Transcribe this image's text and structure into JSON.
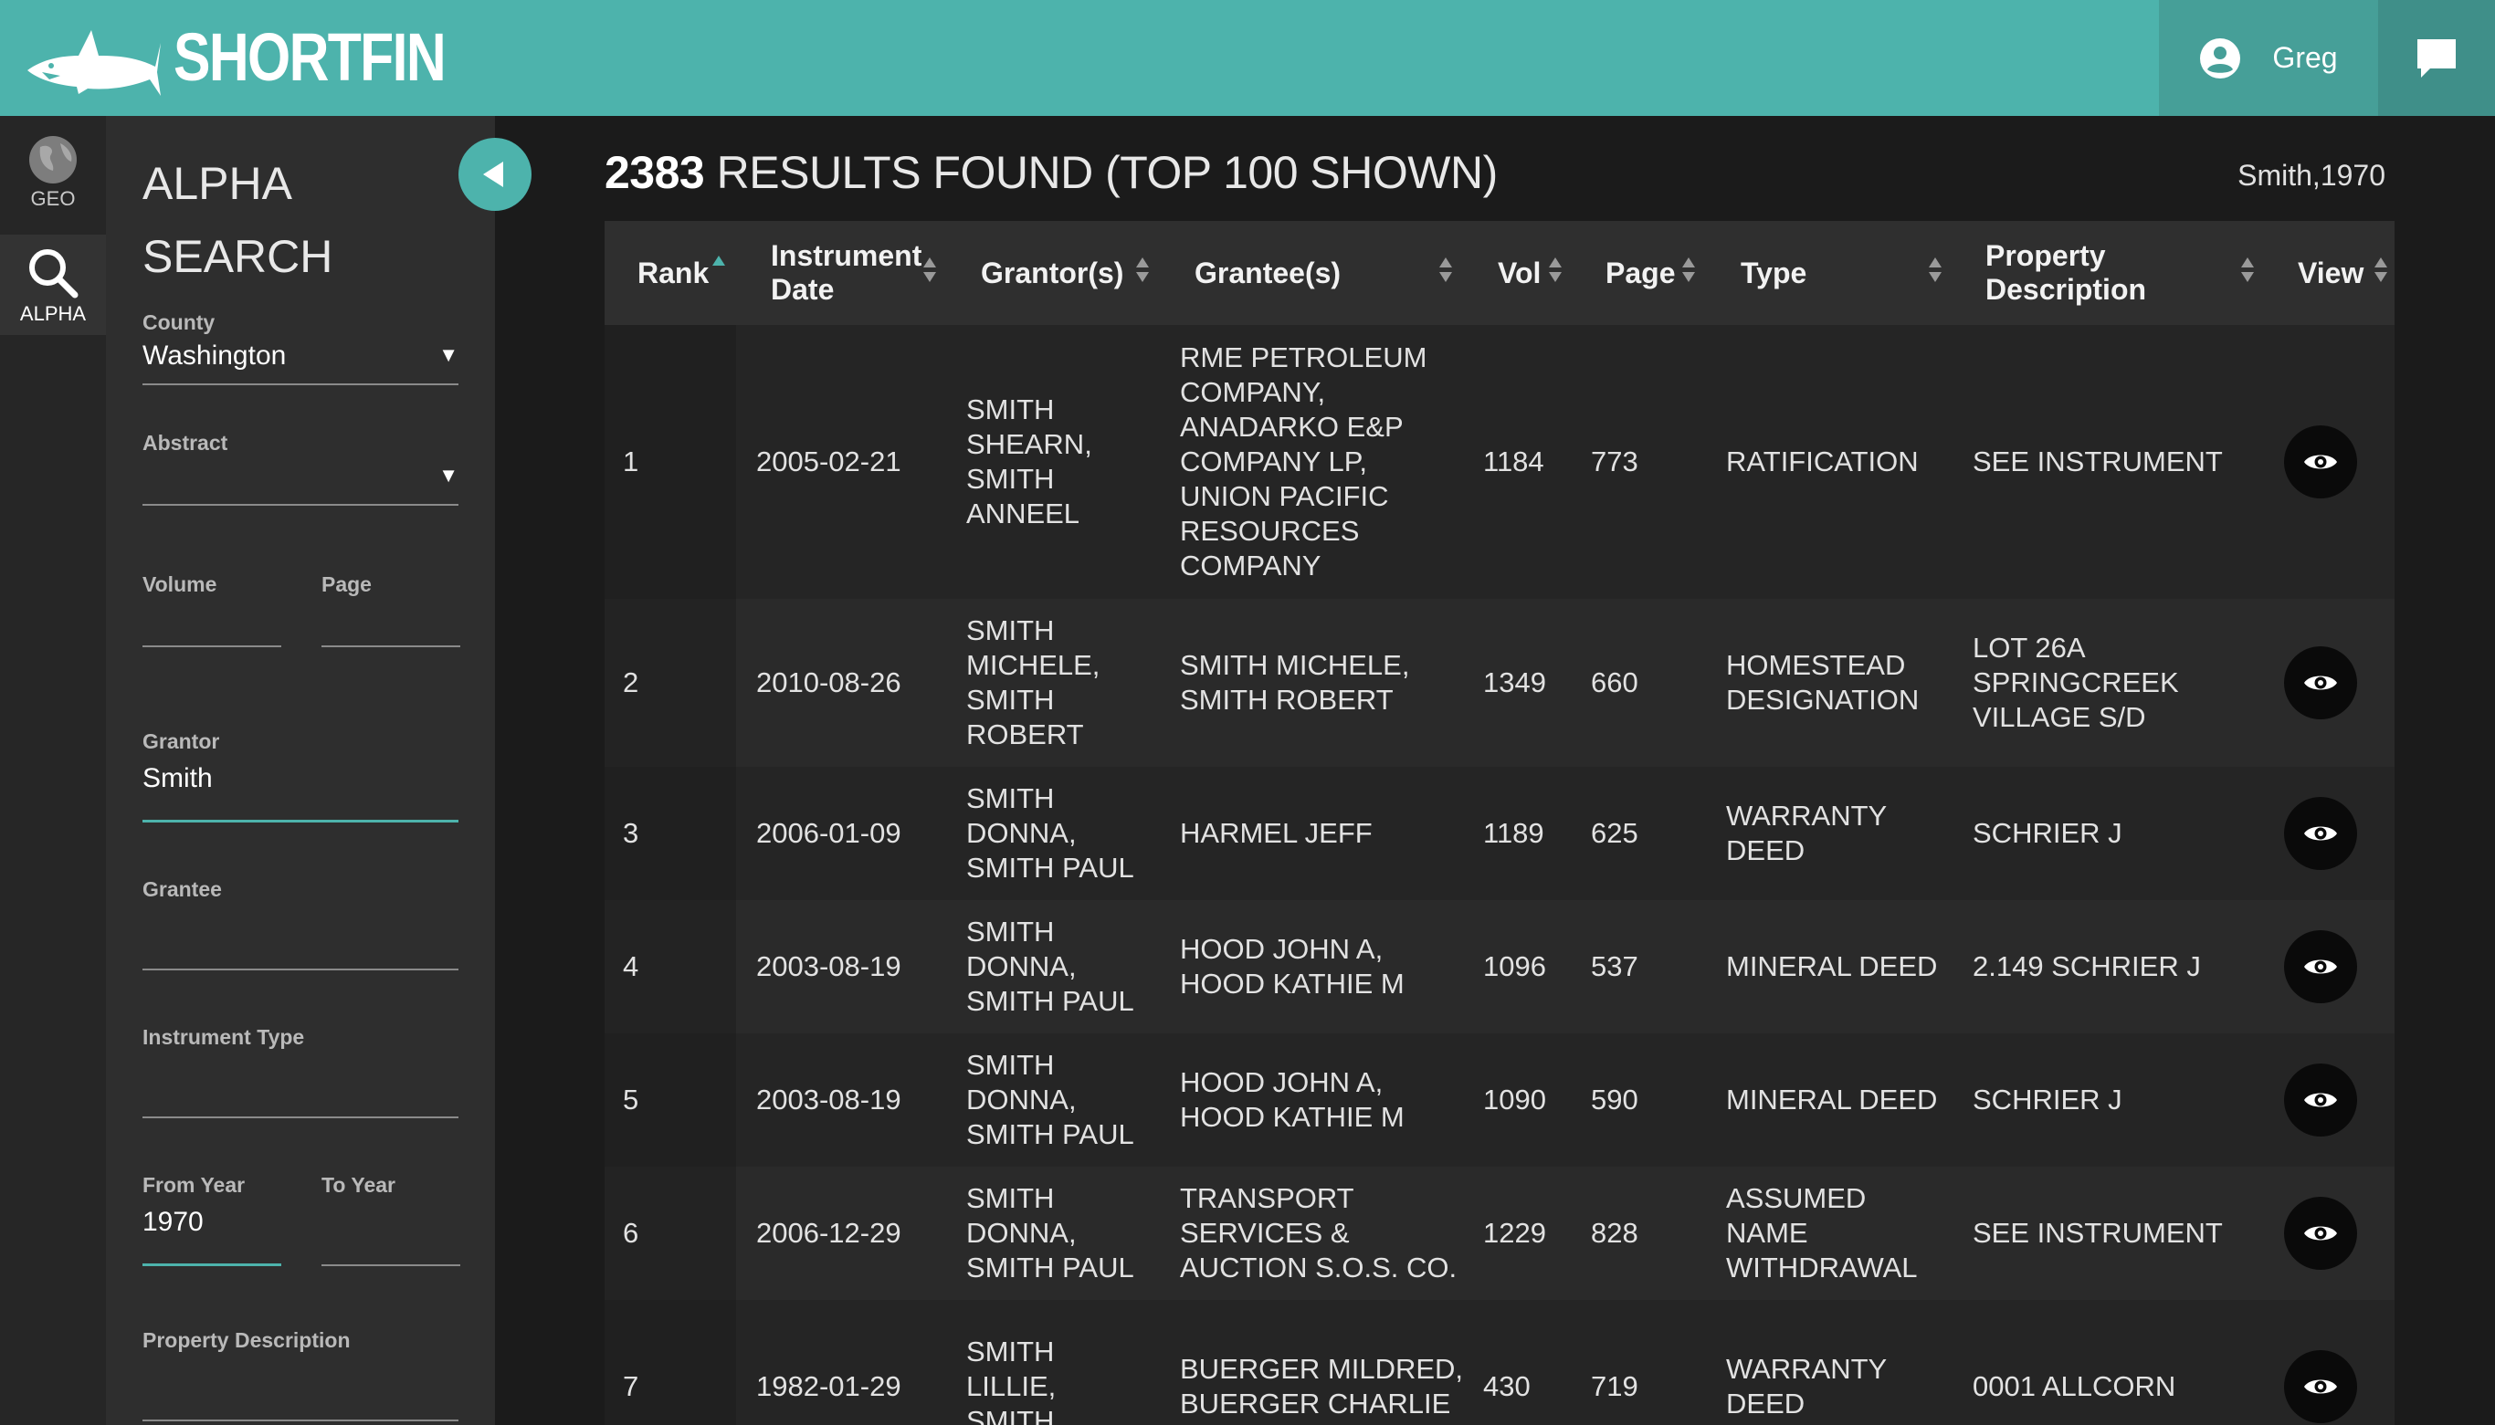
{
  "header": {
    "brand": "SHORTFIN",
    "user_name": "Greg",
    "colors": {
      "accent": "#4db3ac",
      "user_bg": "#469f98",
      "chat_bg": "#3f8f89"
    }
  },
  "rail": {
    "items": [
      {
        "label": "GEO",
        "icon": "globe-icon"
      },
      {
        "label": "ALPHA",
        "icon": "search-icon"
      }
    ]
  },
  "search_panel": {
    "title_line1": "ALPHA",
    "title_line2": "SEARCH",
    "fields": {
      "county": {
        "label": "County",
        "value": "Washington"
      },
      "abstract": {
        "label": "Abstract",
        "value": ""
      },
      "volume": {
        "label": "Volume",
        "value": ""
      },
      "page": {
        "label": "Page",
        "value": ""
      },
      "grantor": {
        "label": "Grantor",
        "value": "Smith"
      },
      "grantee": {
        "label": "Grantee",
        "value": ""
      },
      "instrument_type": {
        "label": "Instrument Type",
        "value": ""
      },
      "from_year": {
        "label": "From Year",
        "value": "1970"
      },
      "to_year": {
        "label": "To Year",
        "value": ""
      },
      "property_description": {
        "label": "Property Description",
        "value": ""
      }
    }
  },
  "results": {
    "count": "2383",
    "title_rest": "RESULTS FOUND (TOP 100 SHOWN)",
    "query": "Smith,1970",
    "columns": {
      "rank": "Rank",
      "instrument_date_1": "Instrument",
      "instrument_date_2": "Date",
      "grantors": "Grantor(s)",
      "grantees": "Grantee(s)",
      "vol": "Vol",
      "page": "Page",
      "type": "Type",
      "property_1": "Property",
      "property_2": "Description",
      "view": "View"
    },
    "rows": [
      {
        "rank": "1",
        "date": "2005-02-21",
        "grantor": [
          "SMITH",
          "SHEARN,",
          "SMITH",
          "ANNEEL"
        ],
        "grantee": [
          "RME PETROLEUM",
          "COMPANY,",
          "ANADARKO E&P",
          "COMPANY LP,",
          "UNION PACIFIC",
          "RESOURCES",
          "COMPANY"
        ],
        "vol": "1184",
        "page": "773",
        "type": [
          "RATIFICATION"
        ],
        "property": [
          "SEE INSTRUMENT"
        ]
      },
      {
        "rank": "2",
        "date": "2010-08-26",
        "grantor": [
          "SMITH",
          "MICHELE,",
          "SMITH",
          "ROBERT"
        ],
        "grantee": [
          "SMITH MICHELE,",
          "SMITH ROBERT"
        ],
        "vol": "1349",
        "page": "660",
        "type": [
          "HOMESTEAD",
          "DESIGNATION"
        ],
        "property": [
          "LOT 26A",
          "SPRINGCREEK",
          "VILLAGE S/D"
        ]
      },
      {
        "rank": "3",
        "date": "2006-01-09",
        "grantor": [
          "SMITH",
          "DONNA,",
          "SMITH PAUL"
        ],
        "grantee": [
          "HARMEL JEFF"
        ],
        "vol": "1189",
        "page": "625",
        "type": [
          "WARRANTY",
          "DEED"
        ],
        "property": [
          "SCHRIER J"
        ]
      },
      {
        "rank": "4",
        "date": "2003-08-19",
        "grantor": [
          "SMITH",
          "DONNA,",
          "SMITH PAUL"
        ],
        "grantee": [
          "HOOD JOHN A,",
          "HOOD KATHIE M"
        ],
        "vol": "1096",
        "page": "537",
        "type": [
          "MINERAL DEED"
        ],
        "property": [
          "2.149 SCHRIER J"
        ]
      },
      {
        "rank": "5",
        "date": "2003-08-19",
        "grantor": [
          "SMITH",
          "DONNA,",
          "SMITH PAUL"
        ],
        "grantee": [
          "HOOD JOHN A,",
          "HOOD KATHIE M"
        ],
        "vol": "1090",
        "page": "590",
        "type": [
          "MINERAL DEED"
        ],
        "property": [
          "SCHRIER J"
        ]
      },
      {
        "rank": "6",
        "date": "2006-12-29",
        "grantor": [
          "SMITH",
          "DONNA,",
          "SMITH PAUL"
        ],
        "grantee": [
          "TRANSPORT",
          "SERVICES &",
          "AUCTION S.O.S. CO."
        ],
        "vol": "1229",
        "page": "828",
        "type": [
          "ASSUMED",
          "NAME",
          "WITHDRAWAL"
        ],
        "property": [
          "SEE INSTRUMENT"
        ]
      },
      {
        "rank": "7",
        "date": "1982-01-29",
        "grantor": [
          "SMITH",
          "LILLIE,",
          "SMITH"
        ],
        "grantee": [
          "BUERGER MILDRED,",
          "BUERGER CHARLIE"
        ],
        "vol": "430",
        "page": "719",
        "type": [
          "WARRANTY",
          "DEED"
        ],
        "property": [
          "0001 ALLCORN"
        ]
      }
    ]
  }
}
